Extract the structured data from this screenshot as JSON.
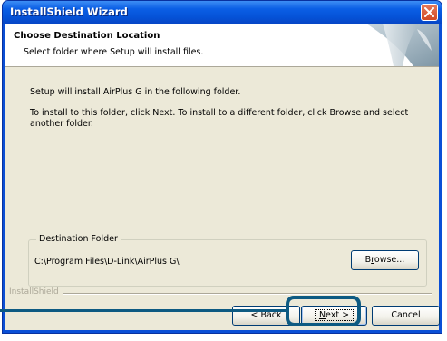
{
  "window": {
    "title": "InstallShield Wizard"
  },
  "header": {
    "title": "Choose Destination Location",
    "subtitle": "Select folder where Setup will install files."
  },
  "body": {
    "line1": "Setup will install AirPlus G in the following folder.",
    "line2a": "To install to this folder, click Next. To install to a different folder, click Browse and select",
    "line2b": "another folder."
  },
  "destination": {
    "legend": "Destination Folder",
    "path": "C:\\Program Files\\D-Link\\AirPlus G\\",
    "browse_pre": "B",
    "browse_ul": "r",
    "browse_post": "owse..."
  },
  "footer": {
    "branding": "InstallShield",
    "back_label": "< Back",
    "next_ul": "N",
    "next_post": "ext >",
    "cancel_label": "Cancel"
  },
  "colors": {
    "titlebar": "#0553d8",
    "dialog_bg": "#ece9d8",
    "callout": "#0d5a82"
  },
  "icons": [
    "close-icon",
    "installshield-header-graphic"
  ]
}
